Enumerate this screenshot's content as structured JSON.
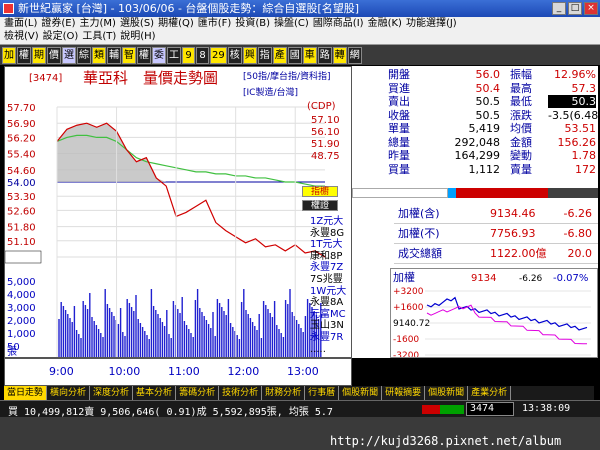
{
  "window": {
    "title": "新世紀贏家 [台灣] - 103/06/06 - 台盤個股走勢：綜合自選股[名望股]",
    "min": "_",
    "max": "□",
    "close": "×"
  },
  "menu": {
    "row1": [
      "畫面(L)",
      "證券(E)",
      "主力(M)",
      "選股(S)",
      "期權(Q)",
      "匯市(F)",
      "投資(B)",
      "操盤(C)",
      "國際商品(I)",
      "金融(K)",
      "功能選擇(J)"
    ],
    "row1_right": "功能選擇(J)",
    "row2": [
      "檢視(V)",
      "設定(O)",
      "工具(T)",
      "說明(H)"
    ]
  },
  "toolbar": [
    "加",
    "權",
    "期",
    "價",
    "選",
    "綜",
    "類",
    "輔",
    "智",
    "權",
    "委",
    "工",
    "9",
    "8",
    "29",
    "核",
    "興",
    "指",
    "產",
    "國",
    "車",
    "路",
    "轉",
    "網"
  ],
  "chart": {
    "code": "[3474]",
    "name": "華亞科",
    "title": "量價走勢圖",
    "tags1": "[50指/摩台指/資科指]",
    "tags2": "[IC製造/台灣]",
    "cdp_label": "(CDP)",
    "cdp_values": [
      "57.10",
      "56.10",
      "51.90",
      "48.75"
    ],
    "price_ticks": [
      "57.70",
      "56.90",
      "56.20",
      "55.40",
      "54.60",
      "54.00",
      "53.30",
      "52.60",
      "51.80",
      "51.10",
      "50.30"
    ],
    "ref_price": "54.00",
    "last_price": "50.30",
    "vol_ticks": [
      "5,000",
      "4,000",
      "3,000",
      "2,000",
      "1,000",
      "50"
    ],
    "vol_unit": "張",
    "time_ticks": [
      "9:00",
      "10:00",
      "11:00",
      "12:00",
      "13:00"
    ]
  },
  "chart_data": {
    "type": "line",
    "title": "量價走勢圖",
    "x": [
      "9:00",
      "9:10",
      "9:20",
      "9:30",
      "9:40",
      "9:50",
      "10:00",
      "10:10",
      "10:20",
      "10:30",
      "10:40",
      "10:50",
      "11:00",
      "11:10",
      "11:20",
      "11:30",
      "11:40",
      "11:50",
      "12:00",
      "12:10",
      "12:20",
      "12:30",
      "12:40",
      "12:50",
      "13:00",
      "13:10",
      "13:20",
      "13:30"
    ],
    "series": [
      {
        "name": "price",
        "values": [
          56.0,
          56.6,
          56.8,
          56.9,
          56.7,
          56.9,
          56.5,
          55.6,
          55.0,
          55.2,
          54.2,
          53.8,
          52.3,
          52.5,
          52.8,
          53.1,
          52.0,
          51.6,
          51.3,
          51.0,
          51.2,
          50.8,
          50.9,
          50.6,
          50.9,
          50.5,
          50.6,
          50.3
        ]
      },
      {
        "name": "average",
        "values": [
          56.0,
          56.2,
          56.3,
          56.3,
          56.2,
          56.2,
          56.0,
          55.6,
          55.2,
          55.0,
          54.9,
          54.8,
          54.7,
          54.6,
          54.5,
          54.5,
          54.4,
          54.4,
          54.3,
          54.3,
          54.2,
          54.2,
          54.1,
          54.0,
          54.0,
          53.9,
          53.8,
          53.8
        ]
      }
    ],
    "ylim": [
      50.3,
      57.7
    ],
    "volume_ylim": [
      0,
      5000
    ]
  },
  "quote": {
    "rows": [
      {
        "l": "開盤",
        "lv": "56.0",
        "r": "振幅",
        "rv": "12.96%"
      },
      {
        "l": "買進",
        "lv": "50.4",
        "r": "最高",
        "rv": "57.3"
      },
      {
        "l": "賣出",
        "lv": "50.5",
        "r": "最低",
        "rv": "50.3"
      },
      {
        "l": "收盤",
        "lv": "50.5",
        "r": "漲跌",
        "rv": "-3.5(6.48)"
      },
      {
        "l": "單量",
        "lv": "5,419",
        "r": "均價",
        "rv": "53.51"
      },
      {
        "l": "總量",
        "lv": "292,048",
        "r": "金額",
        "rv": "156.26"
      },
      {
        "l": "昨量",
        "lv": "164,299",
        "r": "變動",
        "rv": "1.78"
      },
      {
        "l": "買量",
        "lv": "1,112",
        "r": "賣量",
        "rv": "172"
      }
    ],
    "btn1": "指櫥",
    "btn2": "權證",
    "side_list": [
      "1Z元大",
      "永豐8G",
      "1T元大",
      "康和8P",
      "永豐7Z",
      "7S兆豐",
      "1W元大",
      "永豐8A",
      "元富MC",
      "玉山3N",
      "永豐7R",
      "....."
    ],
    "index_rows": [
      {
        "label": "加權(含)",
        "value": "9134.46",
        "chg": "-6.26"
      },
      {
        "label": "加權(不)",
        "value": "7756.93",
        "chg": "-6.80"
      },
      {
        "label": "成交總額",
        "value": "1122.00億",
        "chg": "20.0"
      }
    ],
    "mini": {
      "label": "加權",
      "value": "9134",
      "chg": "-6.26",
      "pct": "-0.07%",
      "ticks": [
        "+3200",
        "+1600",
        "9140.72",
        "-1600",
        "-3200"
      ]
    }
  },
  "tabs": [
    "當日走勢",
    "橫向分析",
    "深度分析",
    "基本分析",
    "籌碼分析",
    "技術分析",
    "財務分析",
    "行事曆",
    "個股新聞",
    "研報摘要",
    "個股新聞",
    "產業分析"
  ],
  "status": {
    "text": "買 10,499,812賣 9,506,646( 0.91)成 5,592,895張, 均張 5.7",
    "code": "3474",
    "time": "13:38:09"
  },
  "footer": {
    "url": "http://kujd3268.pixnet.net/album"
  },
  "colors": {
    "price": "#d00000",
    "avg": "#40c040",
    "volume": "#2020d0",
    "ref": "#0000a0"
  }
}
